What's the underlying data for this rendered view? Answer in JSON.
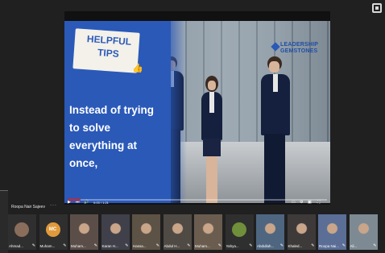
{
  "slide": {
    "tips_title": "HELPFUL TIPS",
    "body_text": "Instead of trying to solve everything at once,",
    "logo_line1": "LEADERSHIP",
    "logo_line2": "GEMSTONES"
  },
  "video": {
    "time": "0:03 / 1:21",
    "progress": 0.05
  },
  "presenter": {
    "name": "Roopa Nair Sajeev",
    "more": "···"
  },
  "participants": [
    {
      "name": "Ahmad...",
      "type": "avatar",
      "initials": "",
      "color": "#8a6d5a"
    },
    {
      "name": "Muham...",
      "type": "avatar",
      "initials": "MC",
      "color": "#e09a3c"
    },
    {
      "name": "Muham...",
      "type": "video",
      "color": "#5b4e48"
    },
    {
      "name": "Karan H...",
      "type": "video",
      "color": "#40404a"
    },
    {
      "name": "Hassa...",
      "type": "video",
      "color": "#5c5245"
    },
    {
      "name": "Abdul H...",
      "type": "video",
      "color": "#4f4a44"
    },
    {
      "name": "Muham...",
      "type": "video",
      "color": "#6a5d4f"
    },
    {
      "name": "Yahya...",
      "type": "avatar",
      "initials": "",
      "color": "#6f8f3a"
    },
    {
      "name": "Abdullah...",
      "type": "video",
      "color": "#4e6680"
    },
    {
      "name": "Khaled...",
      "type": "video",
      "color": "#3e3a3a"
    },
    {
      "name": "Roopa Nai...",
      "type": "video",
      "color": "#5a6e96"
    },
    {
      "name": "Ali...",
      "type": "video",
      "color": "#7d8a93"
    }
  ],
  "mic_icon_glyph": "✎"
}
